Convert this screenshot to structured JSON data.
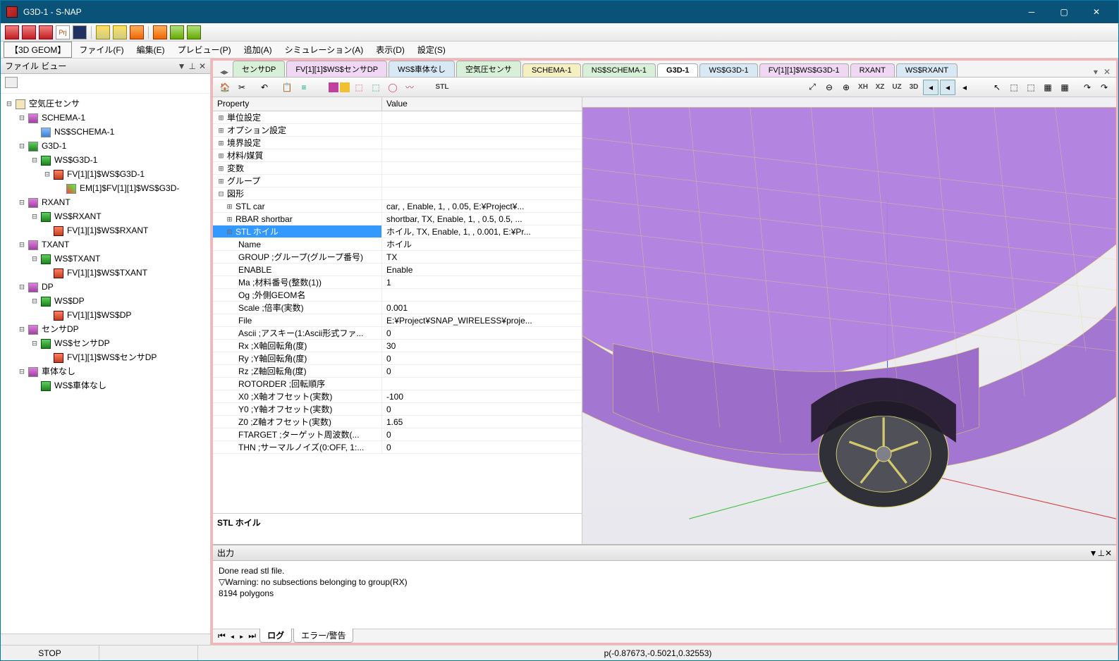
{
  "window": {
    "title": "G3D-1 - S-NAP"
  },
  "menu": {
    "geom": "【3D GEOM】",
    "file": "ファイル(F)",
    "edit": "編集(E)",
    "preview": "プレビュー(P)",
    "add": "追加(A)",
    "sim": "シミュレーション(A)",
    "view": "表示(D)",
    "settings": "設定(S)"
  },
  "fileview": {
    "title": "ファイル ビュー",
    "root": "空気圧センサ",
    "schema": "SCHEMA-1",
    "ns_schema": "NS$SCHEMA-1",
    "g3d": "G3D-1",
    "ws_g3d": "WS$G3D-1",
    "fv_g3d": "FV[1][1]$WS$G3D-1",
    "em_g3d": "EM[1]$FV[1][1]$WS$G3D-",
    "rxant": "RXANT",
    "ws_rxant": "WS$RXANT",
    "fv_rxant": "FV[1][1]$WS$RXANT",
    "txant": "TXANT",
    "ws_txant": "WS$TXANT",
    "fv_txant": "FV[1][1]$WS$TXANT",
    "dp": "DP",
    "ws_dp": "WS$DP",
    "fv_dp": "FV[1][1]$WS$DP",
    "sensadp": "センサDP",
    "ws_sensadp": "WS$センサDP",
    "fv_sensadp": "FV[1][1]$WS$センサDP",
    "shatai": "車体なし",
    "ws_shatai": "WS$車体なし"
  },
  "tabs": {
    "t0": "センサDP",
    "t1": "FV[1][1]$WS$センサDP",
    "t2": "WS$車体なし",
    "t3": "空気圧センサ",
    "t4": "SCHEMA-1",
    "t5": "NS$SCHEMA-1",
    "t6": "G3D-1",
    "t7": "WS$G3D-1",
    "t8": "FV[1][1]$WS$G3D-1",
    "t9": "RXANT",
    "t10": "WS$RXANT"
  },
  "toolbar2": {
    "XH": "XH",
    "XZ": "XZ",
    "UZ": "UZ",
    "3D": "3D",
    "STL": "STL"
  },
  "prop": {
    "col_prop": "Property",
    "col_val": "Value",
    "unit": "単位設定",
    "option": "オプション設定",
    "boundary": "境界設定",
    "material": "材料/媒質",
    "vars": "変数",
    "group": "グループ",
    "shape": "図形",
    "stl_car": "STL car",
    "stl_car_v": "car, , Enable, 1, , 0.05, E:¥Project¥...",
    "rbar": "RBAR shortbar",
    "rbar_v": "shortbar, TX, Enable, 1, , 0.5, 0.5, ...",
    "stl_wheel": "STL ホイル",
    "stl_wheel_v": "ホイル, TX, Enable, 1, , 0.001, E:¥Pr...",
    "name": "Name",
    "name_v": "ホイル",
    "groupk": "GROUP ;グループ(グループ番号)",
    "group_v": "TX",
    "enable": "ENABLE",
    "enable_v": "Enable",
    "ma": "Ma ;材料番号(整数(1))",
    "ma_v": "1",
    "og": "Og ;外側GEOM名",
    "og_v": "",
    "scale": "Scale ;倍率(実数)",
    "scale_v": "0.001",
    "file": "File",
    "file_v": "E:¥Project¥SNAP_WIRELESS¥proje...",
    "ascii": "Ascii ;アスキー(1:Ascii形式ファ...",
    "ascii_v": "0",
    "rx": "Rx ;X軸回転角(度)",
    "rx_v": "30",
    "ry": "Ry ;Y軸回転角(度)",
    "ry_v": "0",
    "rz": "Rz ;Z軸回転角(度)",
    "rz_v": "0",
    "rotorder": "ROTORDER ;回転順序",
    "rotorder_v": "",
    "x0": "X0 ;X軸オフセット(実数)",
    "x0_v": "-100",
    "y0": "Y0 ;Y軸オフセット(実数)",
    "y0_v": "0",
    "z0": "Z0 ;Z軸オフセット(実数)",
    "z0_v": "1.65",
    "ftarget": "FTARGET ;ターゲット周波数(...",
    "ftarget_v": "0",
    "thn": "THN ;サーマルノイズ(0:OFF, 1:...",
    "thn_v": "0",
    "info": "STL ホイル"
  },
  "output": {
    "title": "出力",
    "l1": "Done read stl file.",
    "l2": "▽Warning: no subsections belonging to group(RX)",
    "l3": "8194 polygons",
    "tab_log": "ログ",
    "tab_err": "エラー/警告"
  },
  "status": {
    "stop": "STOP",
    "coords": "p(-0.87673,-0.5021,0.32553)"
  }
}
